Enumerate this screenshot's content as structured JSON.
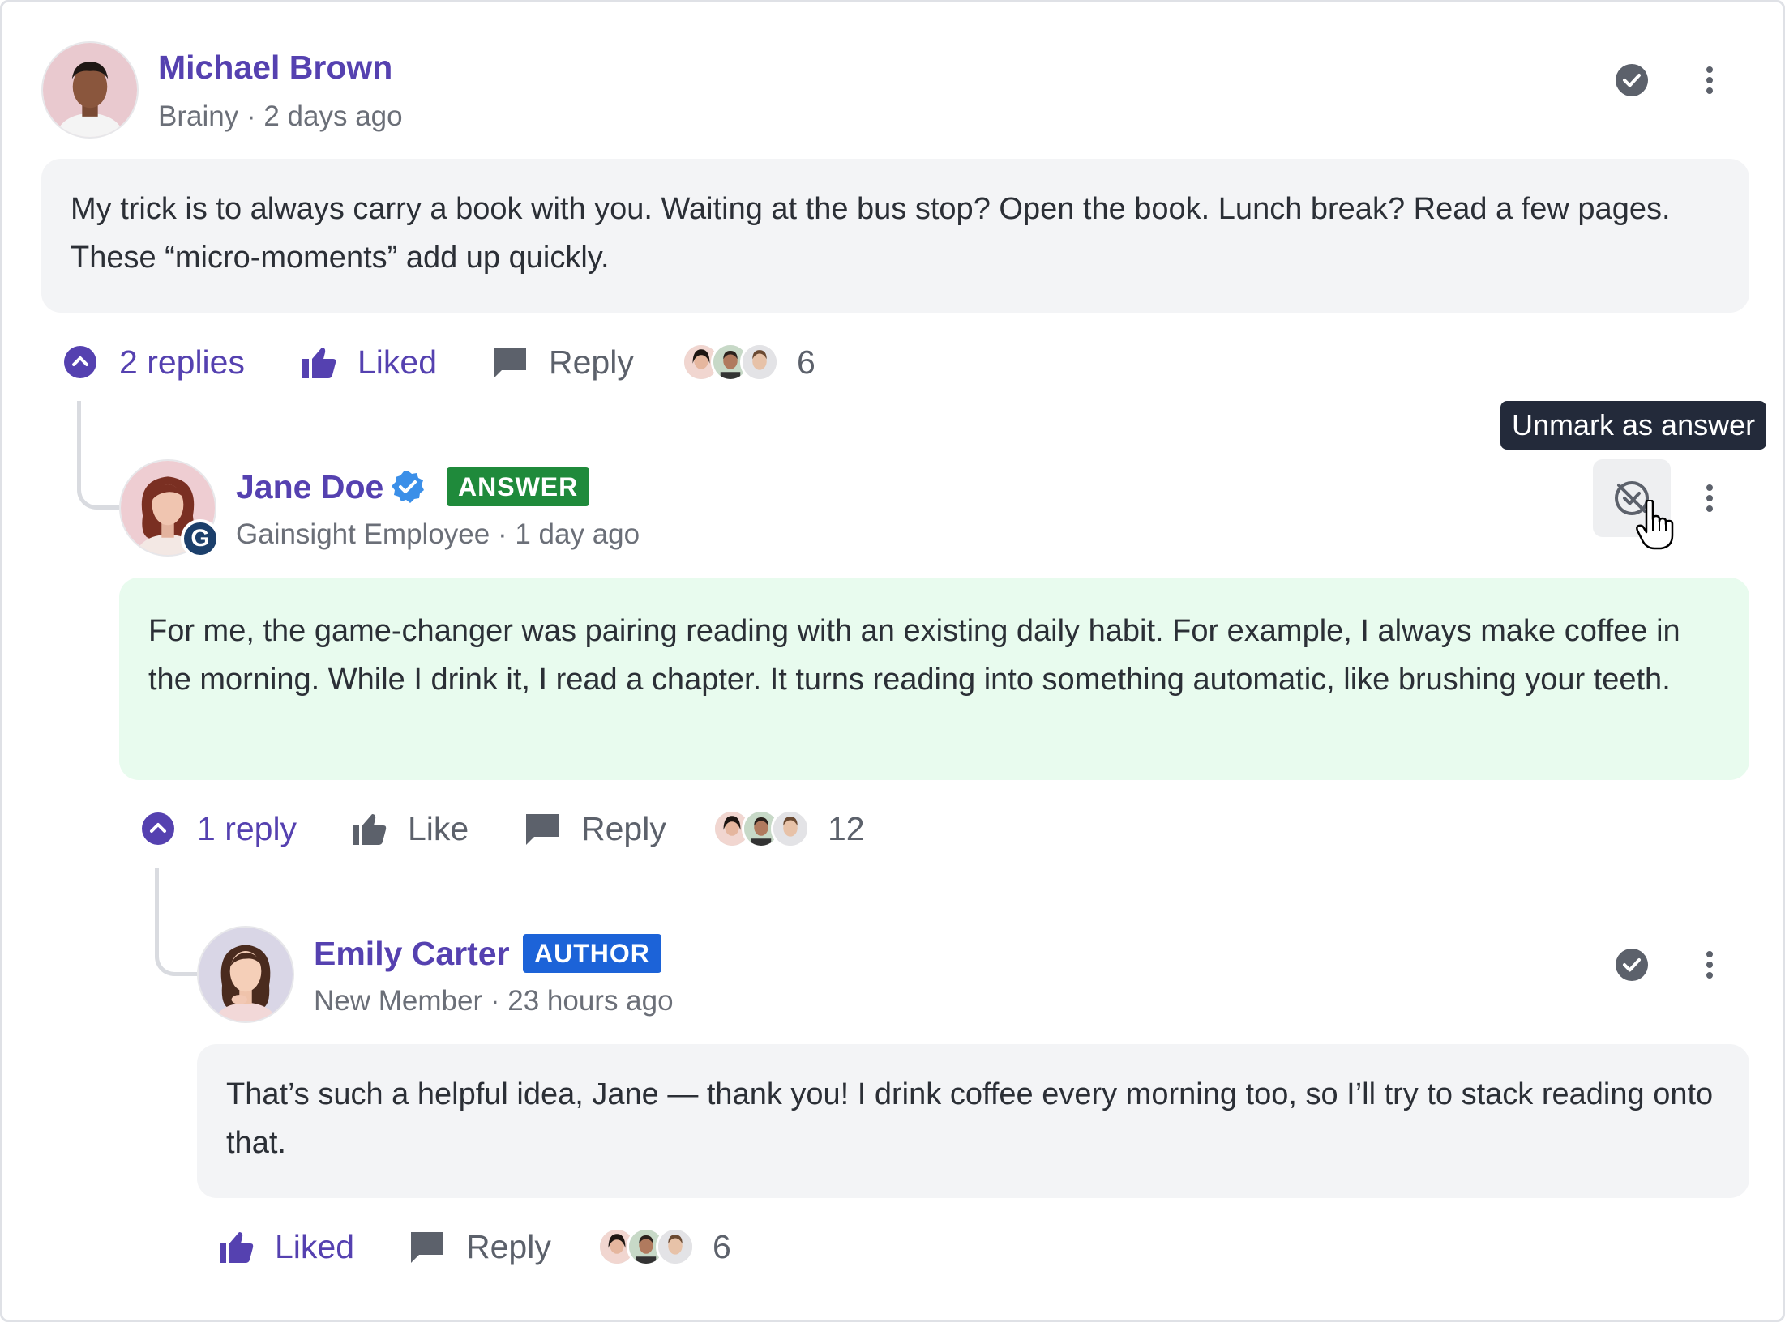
{
  "comments": [
    {
      "author": "Michael Brown",
      "role": "Brainy",
      "time": "2 days ago",
      "body": "My trick is to always carry a book with you. Waiting at the bus stop? Open the book. Lunch break? Read a few pages. These “micro-moments” add up quickly.",
      "replies_label": "2 replies",
      "like_label": "Liked",
      "reply_label": "Reply",
      "reaction_count": "6"
    },
    {
      "author": "Jane Doe",
      "badge": "ANSWER",
      "avatar_badge": "G",
      "role": "Gainsight Employee",
      "time": "1 day ago",
      "body": "For me, the game-changer was pairing reading with an existing daily habit. For example, I always make coffee in the morning. While I drink it, I read a chapter. It turns reading into something automatic, like brushing your teeth.",
      "replies_label": "1 reply",
      "like_label": "Like",
      "reply_label": "Reply",
      "reaction_count": "12",
      "tooltip": "Unmark as answer"
    },
    {
      "author": "Emily Carter",
      "badge": "AUTHOR",
      "role": "New Member",
      "time": "23 hours ago",
      "body": "That’s such a helpful idea, Jane — thank you! I drink coffee every morning too, so I’ll try to stack reading onto that.",
      "like_label": "Liked",
      "reply_label": "Reply",
      "reaction_count": "6"
    }
  ],
  "meta_separator": "·",
  "colors": {
    "accent": "#5541b0",
    "answer_badge": "#1f8a3b",
    "author_badge": "#1c63d8",
    "answer_bg": "#e8fbee",
    "body_bg": "#f3f4f6",
    "verified": "#3b8fe8",
    "tooltip_bg": "#232a3a"
  },
  "icons": [
    "check-circle-icon",
    "more-vertical-icon",
    "chevron-up-icon",
    "thumbs-up-icon",
    "comment-icon",
    "verified-icon",
    "unmark-answer-icon",
    "hand-cursor-icon"
  ]
}
